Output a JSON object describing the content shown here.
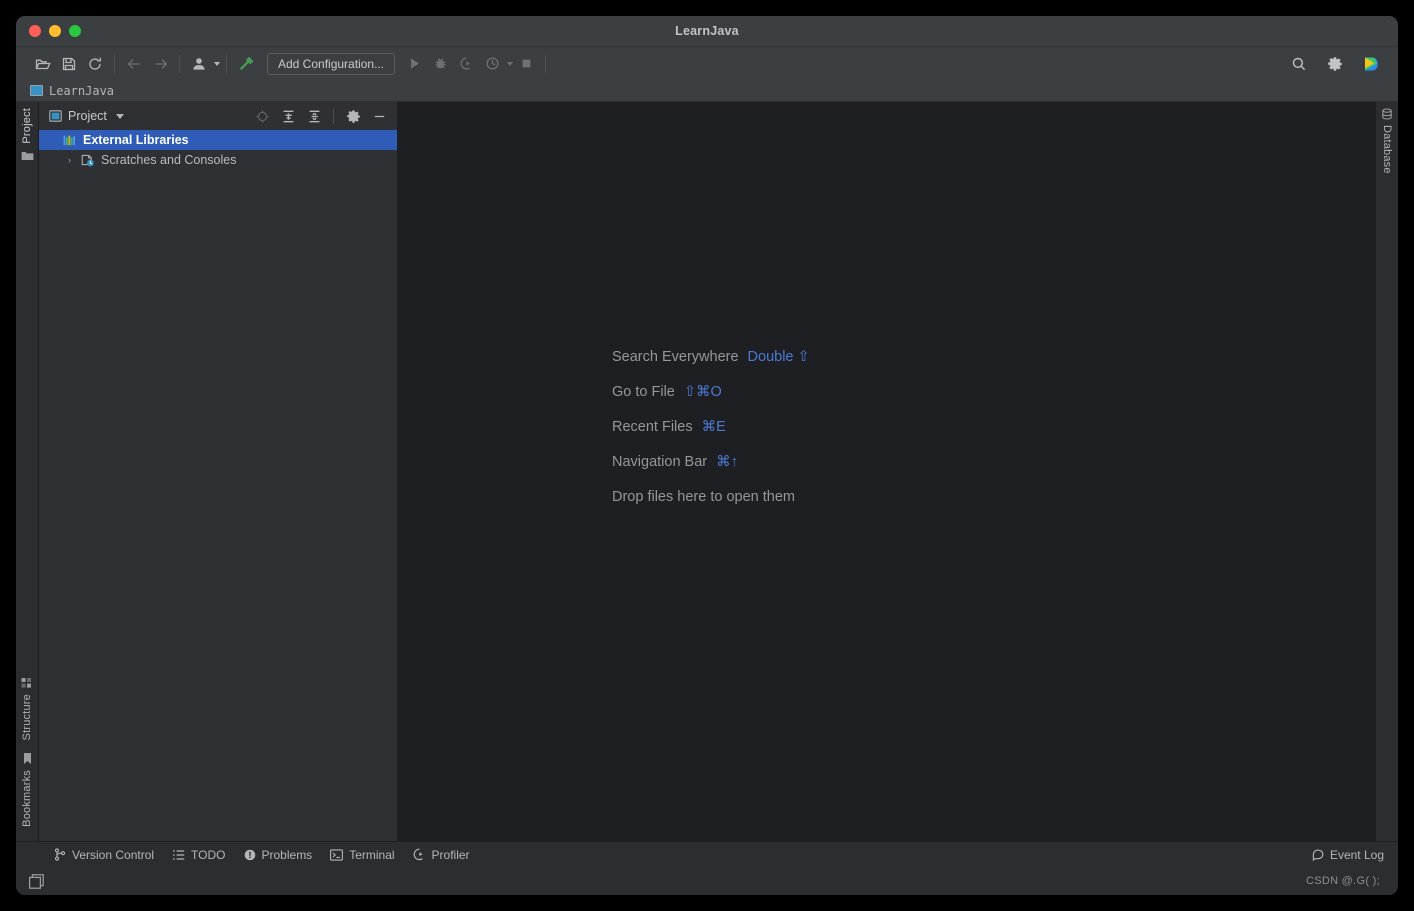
{
  "window": {
    "title": "LearnJava",
    "traffic_lights": [
      "close",
      "minimize",
      "maximize"
    ]
  },
  "toolbar": {
    "open_label": "Open",
    "save_label": "Save All",
    "sync_label": "Sync",
    "back_label": "Back",
    "forward_label": "Forward",
    "profile_label": "Profile",
    "build_label": "Build Project",
    "add_configuration_label": "Add Configuration...",
    "run_label": "Run",
    "debug_label": "Debug",
    "run_coverage_label": "Run with Coverage",
    "profile_run_label": "Profile",
    "stop_label": "Stop",
    "search_label": "Search",
    "settings_label": "Settings",
    "ide_label": "Code With Me"
  },
  "navbar": {
    "project_label": "LearnJava"
  },
  "left_strip": {
    "top_items": [
      {
        "label": "Project",
        "icon": "folder-icon",
        "active": true
      }
    ],
    "bottom_items": [
      {
        "label": "Structure",
        "icon": "structure-icon",
        "active": false
      },
      {
        "label": "Bookmarks",
        "icon": "bookmark-icon",
        "active": false
      }
    ]
  },
  "right_strip": {
    "items": [
      {
        "label": "Database",
        "icon": "database-icon",
        "active": false
      }
    ]
  },
  "project_panel": {
    "title": "Project",
    "toolbar": {
      "locate_label": "Select Opened File",
      "expand_all_label": "Expand All",
      "collapse_all_label": "Collapse All",
      "options_label": "Options",
      "hide_label": "Hide"
    },
    "tree": [
      {
        "label": "External Libraries",
        "icon": "libraries-icon",
        "selected": true,
        "has_arrow": false,
        "arrow": ""
      },
      {
        "label": "Scratches and Consoles",
        "icon": "scratches-icon",
        "selected": false,
        "has_arrow": true,
        "arrow": "›"
      }
    ]
  },
  "editor": {
    "hints": [
      {
        "text": "Search Everywhere",
        "shortcut": "Double ⇧"
      },
      {
        "text": "Go to File",
        "shortcut": "⇧⌘O"
      },
      {
        "text": "Recent Files",
        "shortcut": "⌘E"
      },
      {
        "text": "Navigation Bar",
        "shortcut": "⌘↑"
      }
    ],
    "drop_hint": "Drop files here to open them"
  },
  "bottom_bar": {
    "items": [
      {
        "label": "Version Control",
        "icon": "branch-icon"
      },
      {
        "label": "TODO",
        "icon": "list-icon"
      },
      {
        "label": "Problems",
        "icon": "warning-icon"
      },
      {
        "label": "Terminal",
        "icon": "terminal-icon"
      },
      {
        "label": "Profiler",
        "icon": "profiler-icon"
      }
    ],
    "event_log_label": "Event Log",
    "event_log_icon": "balloon-icon"
  },
  "status_bar": {
    "layout_toggle_label": "Layout",
    "watermark": "CSDN @.G( );"
  },
  "colors": {
    "window_bg": "#2b2d30",
    "toolbar_bg": "#3c3f41",
    "panel_bg": "#2f3033",
    "editor_bg": "#1e1f22",
    "selection_blue": "#2f5cb6",
    "accent_blue": "#4d79d4",
    "text_primary": "#b9bbbd",
    "text_dim": "#959799",
    "build_green": "#499c54"
  }
}
